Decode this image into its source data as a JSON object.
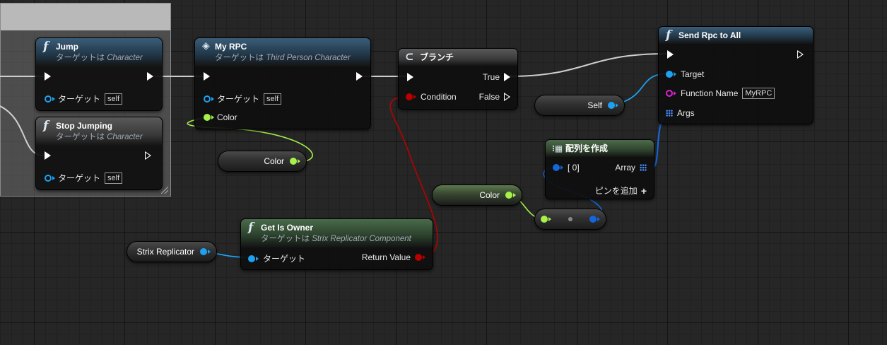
{
  "nodes": {
    "jump": {
      "icon": "f",
      "title": "Jump",
      "target_label": "ターゲットは",
      "target_class": "Character",
      "pin_target": "ターゲット",
      "self_value": "self"
    },
    "stop_jumping": {
      "icon": "f",
      "title": "Stop Jumping",
      "target_label": "ターゲットは",
      "target_class": "Character",
      "pin_target": "ターゲット",
      "self_value": "self"
    },
    "my_rpc": {
      "title": "My RPC",
      "target_label": "ターゲットは",
      "target_class": "Third Person Character",
      "pin_target": "ターゲット",
      "self_value": "self",
      "pin_color": "Color"
    },
    "branch": {
      "title": "ブランチ",
      "pin_condition": "Condition",
      "pin_true": "True",
      "pin_false": "False"
    },
    "send_rpc": {
      "icon": "f",
      "title": "Send Rpc to All",
      "pin_target": "Target",
      "pin_function_name": "Function Name",
      "function_name_value": "MyRPC",
      "pin_args": "Args"
    },
    "make_array": {
      "title": "配列を作成",
      "pin_index": "[ 0]",
      "pin_array": "Array",
      "add_pin": "ピンを追加"
    },
    "get_is_owner": {
      "icon": "f",
      "title": "Get Is Owner",
      "target_label": "ターゲットは",
      "target_class": "Strix Replicator Component",
      "pin_target": "ターゲット",
      "pin_return": "Return Value"
    }
  },
  "variables": {
    "self": "Self",
    "color_1": "Color",
    "color_2": "Color",
    "strix_replicator": "Strix Replicator"
  },
  "colors": {
    "exec": "#ffffff",
    "object_pin": "#1da1f2",
    "struct_color_pin": "#a6f14a",
    "bool_pin": "#b80000",
    "name_pin": "#e021d6",
    "wildcard_pin": "#1566d8"
  }
}
